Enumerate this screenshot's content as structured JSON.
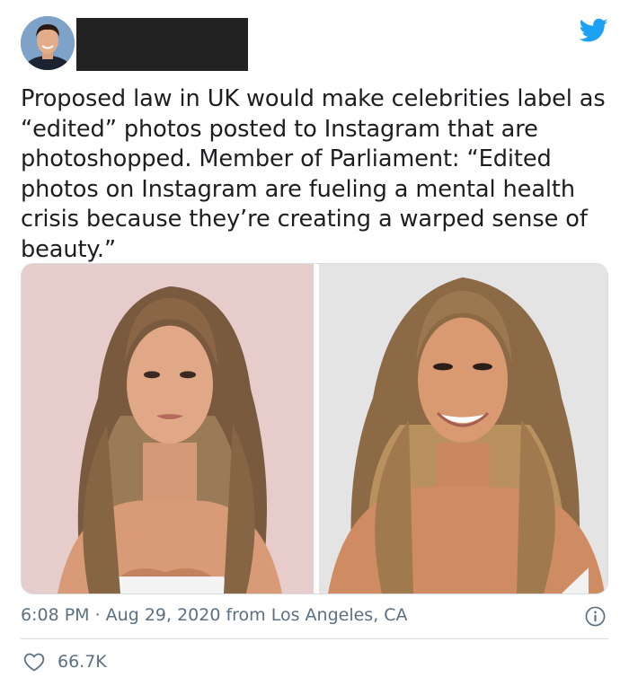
{
  "tweet": {
    "text": "Proposed law in UK would make celebrities label as “edited” photos posted to Instagram that are photoshopped. Member of Parliament: “Edited photos on Instagram are fueling a mental health crisis because they’re creating a warped sense of beauty.”",
    "timestamp": "6:08 PM · Aug 29, 2020 from Los Angeles, CA",
    "likes": "66.7K"
  },
  "icons": {
    "brand": "twitter-bird-icon",
    "info": "info-icon",
    "like": "heart-icon"
  },
  "colors": {
    "twitter_blue": "#1da1f2",
    "meta_gray": "#5b7083",
    "redaction": "#222222"
  }
}
